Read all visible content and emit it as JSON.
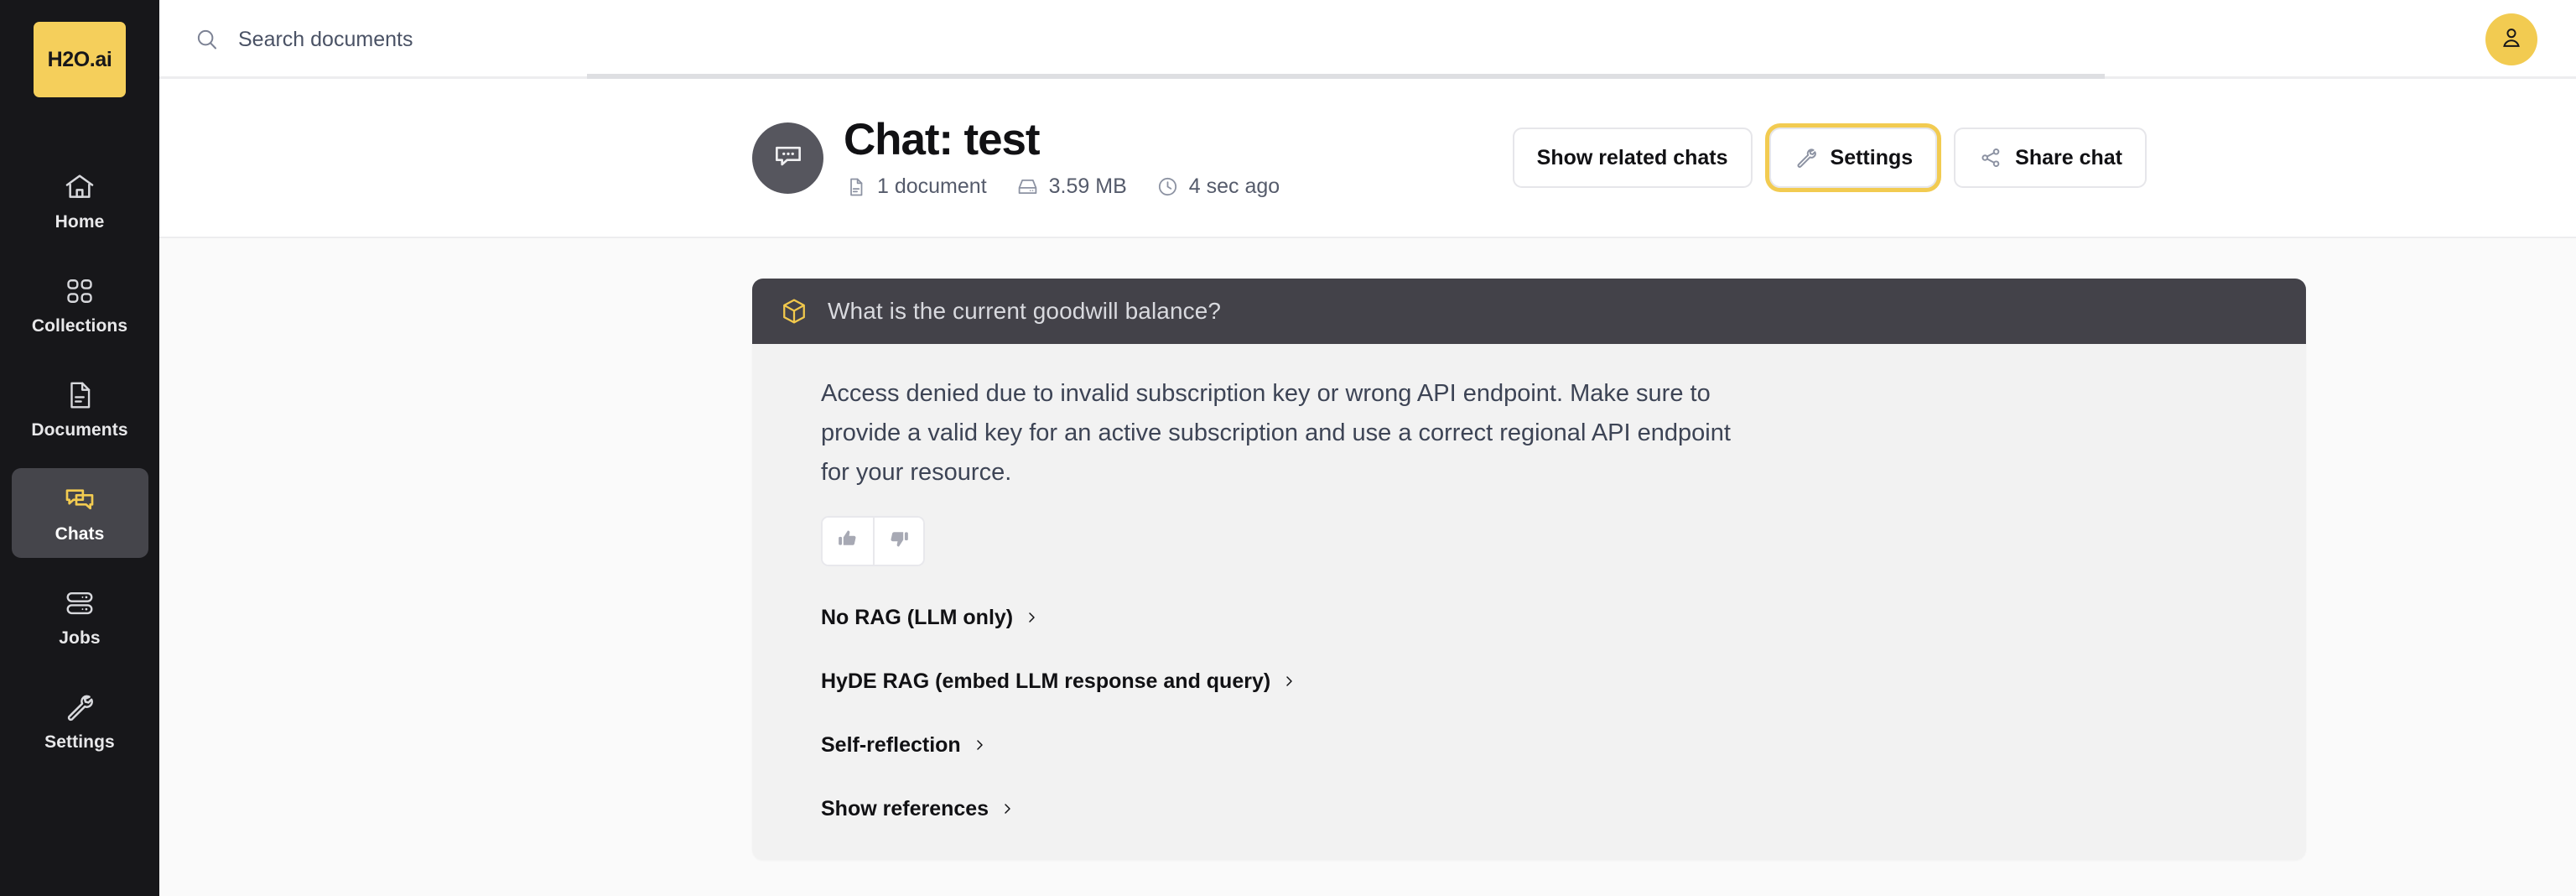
{
  "brand": {
    "logo_text": "H2O",
    "logo_suffix": ".ai",
    "accent_color": "#F5CF5B"
  },
  "sidebar": {
    "items": [
      {
        "label": "Home",
        "icon": "home-icon",
        "active": false
      },
      {
        "label": "Collections",
        "icon": "collections-icon",
        "active": false
      },
      {
        "label": "Documents",
        "icon": "documents-icon",
        "active": false
      },
      {
        "label": "Chats",
        "icon": "chats-icon",
        "active": true
      },
      {
        "label": "Jobs",
        "icon": "jobs-icon",
        "active": false
      },
      {
        "label": "Settings",
        "icon": "settings-icon",
        "active": false
      }
    ]
  },
  "topbar": {
    "search_placeholder": "Search documents",
    "search_value": "",
    "search_icon": "search-icon",
    "avatar_icon": "user-icon"
  },
  "chat_header": {
    "avatar_icon": "chat-bubble-icon",
    "title": "Chat: test",
    "meta": [
      {
        "icon": "document-icon",
        "text": "1 document"
      },
      {
        "icon": "storage-icon",
        "text": "3.59 MB"
      },
      {
        "icon": "clock-icon",
        "text": "4 sec ago"
      }
    ],
    "actions": [
      {
        "label": "Show related chats",
        "icon": null,
        "focused": false
      },
      {
        "label": "Settings",
        "icon": "wrench-icon",
        "focused": true
      },
      {
        "label": "Share chat",
        "icon": "share-icon",
        "focused": false
      }
    ]
  },
  "message": {
    "question_icon": "cube-icon",
    "question": "What is the current goodwill balance?",
    "answer": "Access denied due to invalid subscription key or wrong API endpoint. Make sure to provide a valid key for an active subscription and use a correct regional API endpoint for your resource.",
    "rating": {
      "thumbs_up": "thumbs-up-icon",
      "thumbs_down": "thumbs-down-icon"
    },
    "expanders": [
      {
        "label": "No RAG (LLM only)"
      },
      {
        "label": "HyDE RAG (embed LLM response and query)"
      },
      {
        "label": "Self-reflection"
      },
      {
        "label": "Show references"
      }
    ]
  }
}
